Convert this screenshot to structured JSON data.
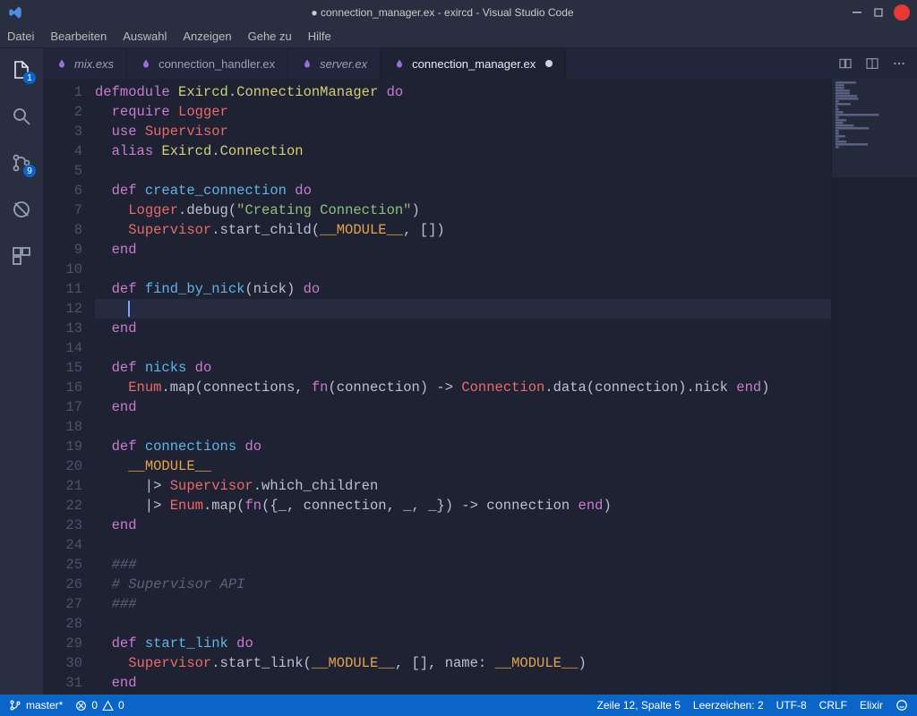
{
  "window": {
    "title": "● connection_manager.ex - exircd - Visual Studio Code"
  },
  "menubar": {
    "items": [
      "Datei",
      "Bearbeiten",
      "Auswahl",
      "Anzeigen",
      "Gehe zu",
      "Hilfe"
    ]
  },
  "activitybar": {
    "explorer_badge": "1",
    "scm_badge": "9"
  },
  "tabs": {
    "items": [
      {
        "label": "mix.exs",
        "icon": "elixir",
        "italic": true,
        "dirty": false,
        "active": false
      },
      {
        "label": "connection_handler.ex",
        "icon": "elixir",
        "italic": false,
        "dirty": false,
        "active": false
      },
      {
        "label": "server.ex",
        "icon": "elixir",
        "italic": true,
        "dirty": false,
        "active": false
      },
      {
        "label": "connection_manager.ex",
        "icon": "elixir",
        "italic": false,
        "dirty": true,
        "active": true
      }
    ]
  },
  "editor": {
    "cursor_line": 12,
    "lines": [
      [
        [
          "defmodule",
          "kw"
        ],
        [
          " ",
          "op"
        ],
        [
          "Exircd",
          "mod"
        ],
        [
          ".",
          "op"
        ],
        [
          "ConnectionManager",
          "mod"
        ],
        [
          " ",
          "op"
        ],
        [
          "do",
          "kw"
        ]
      ],
      [
        [
          "  ",
          "op"
        ],
        [
          "require",
          "kw"
        ],
        [
          " ",
          "op"
        ],
        [
          "Logger",
          "red"
        ]
      ],
      [
        [
          "  ",
          "op"
        ],
        [
          "use",
          "kw"
        ],
        [
          " ",
          "op"
        ],
        [
          "Supervisor",
          "red"
        ]
      ],
      [
        [
          "  ",
          "op"
        ],
        [
          "alias",
          "kw"
        ],
        [
          " ",
          "op"
        ],
        [
          "Exircd",
          "mod"
        ],
        [
          ".",
          "op"
        ],
        [
          "Connection",
          "mod"
        ]
      ],
      [],
      [
        [
          "  ",
          "op"
        ],
        [
          "def",
          "kw"
        ],
        [
          " ",
          "op"
        ],
        [
          "create_connection",
          "fn"
        ],
        [
          " ",
          "op"
        ],
        [
          "do",
          "kw"
        ]
      ],
      [
        [
          "    ",
          "op"
        ],
        [
          "Logger",
          "red"
        ],
        [
          ".debug(",
          "op"
        ],
        [
          "\"Creating Connection\"",
          "str"
        ],
        [
          ")",
          "op"
        ]
      ],
      [
        [
          "    ",
          "op"
        ],
        [
          "Supervisor",
          "red"
        ],
        [
          ".start_child(",
          "op"
        ],
        [
          "__MODULE__",
          "const"
        ],
        [
          ", [])",
          "op"
        ]
      ],
      [
        [
          "  ",
          "op"
        ],
        [
          "end",
          "kw"
        ]
      ],
      [],
      [
        [
          "  ",
          "op"
        ],
        [
          "def",
          "kw"
        ],
        [
          " ",
          "op"
        ],
        [
          "find_by_nick",
          "fn"
        ],
        [
          "(nick) ",
          "op"
        ],
        [
          "do",
          "kw"
        ]
      ],
      [
        [
          "    ",
          "op"
        ]
      ],
      [
        [
          "  ",
          "op"
        ],
        [
          "end",
          "kw"
        ]
      ],
      [],
      [
        [
          "  ",
          "op"
        ],
        [
          "def",
          "kw"
        ],
        [
          " ",
          "op"
        ],
        [
          "nicks",
          "fn"
        ],
        [
          " ",
          "op"
        ],
        [
          "do",
          "kw"
        ]
      ],
      [
        [
          "    ",
          "op"
        ],
        [
          "Enum",
          "red"
        ],
        [
          ".map(connections, ",
          "op"
        ],
        [
          "fn",
          "kw"
        ],
        [
          "(connection) -> ",
          "op"
        ],
        [
          "Connection",
          "red"
        ],
        [
          ".data(connection).nick ",
          "op"
        ],
        [
          "end",
          "kw"
        ],
        [
          ")",
          "op"
        ]
      ],
      [
        [
          "  ",
          "op"
        ],
        [
          "end",
          "kw"
        ]
      ],
      [],
      [
        [
          "  ",
          "op"
        ],
        [
          "def",
          "kw"
        ],
        [
          " ",
          "op"
        ],
        [
          "connections",
          "fn"
        ],
        [
          " ",
          "op"
        ],
        [
          "do",
          "kw"
        ]
      ],
      [
        [
          "    ",
          "op"
        ],
        [
          "__MODULE__",
          "const"
        ]
      ],
      [
        [
          "      |> ",
          "op"
        ],
        [
          "Supervisor",
          "red"
        ],
        [
          ".which_children",
          "op"
        ]
      ],
      [
        [
          "      |> ",
          "op"
        ],
        [
          "Enum",
          "red"
        ],
        [
          ".map(",
          "op"
        ],
        [
          "fn",
          "kw"
        ],
        [
          "({_, connection, _, _}) -> connection ",
          "op"
        ],
        [
          "end",
          "kw"
        ],
        [
          ")",
          "op"
        ]
      ],
      [
        [
          "  ",
          "op"
        ],
        [
          "end",
          "kw"
        ]
      ],
      [],
      [
        [
          "  ",
          "op"
        ],
        [
          "###",
          "cmt"
        ]
      ],
      [
        [
          "  ",
          "op"
        ],
        [
          "# Supervisor API",
          "cmt"
        ]
      ],
      [
        [
          "  ",
          "op"
        ],
        [
          "###",
          "cmt"
        ]
      ],
      [],
      [
        [
          "  ",
          "op"
        ],
        [
          "def",
          "kw"
        ],
        [
          " ",
          "op"
        ],
        [
          "start_link",
          "fn"
        ],
        [
          " ",
          "op"
        ],
        [
          "do",
          "kw"
        ]
      ],
      [
        [
          "    ",
          "op"
        ],
        [
          "Supervisor",
          "red"
        ],
        [
          ".start_link(",
          "op"
        ],
        [
          "__MODULE__",
          "const"
        ],
        [
          ", [], ",
          "op"
        ],
        [
          "name:",
          "var"
        ],
        [
          " ",
          "op"
        ],
        [
          "__MODULE__",
          "const"
        ],
        [
          ")",
          "op"
        ]
      ],
      [
        [
          "  ",
          "op"
        ],
        [
          "end",
          "kw"
        ]
      ]
    ]
  },
  "statusbar": {
    "branch": "master*",
    "errors": "0",
    "warnings": "0",
    "position": "Zeile 12, Spalte 5",
    "spaces": "Leerzeichen: 2",
    "encoding": "UTF-8",
    "eol": "CRLF",
    "language": "Elixir"
  }
}
